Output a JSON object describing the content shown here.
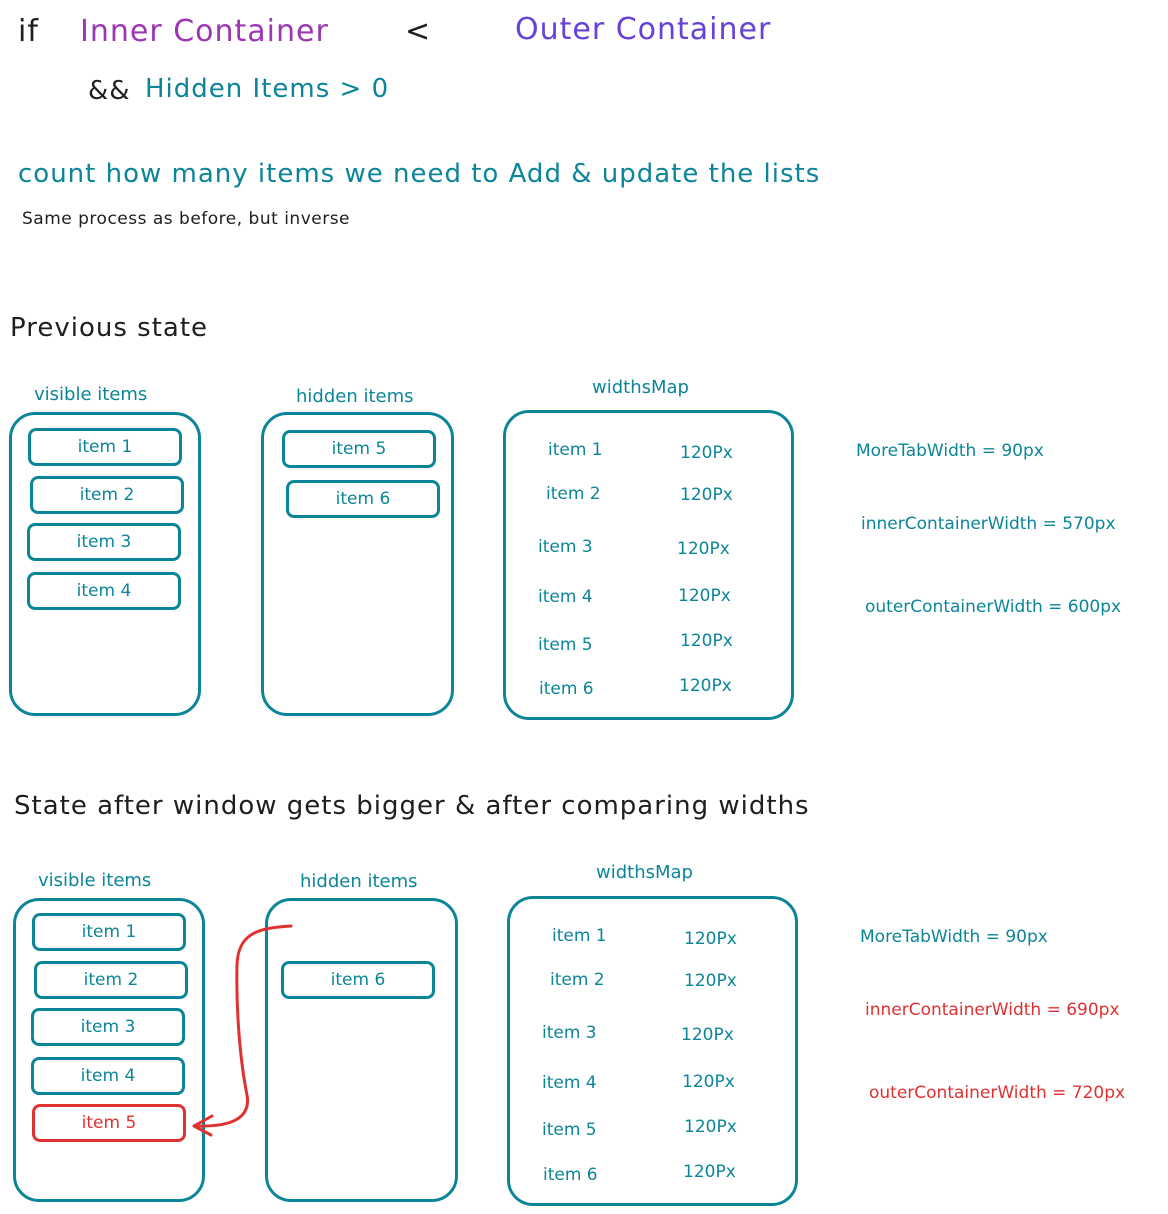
{
  "condition": {
    "if_kw": "if",
    "left": "Inner Container",
    "op": "<",
    "right": "Outer Container",
    "and_kw": "&&",
    "second": "Hidden Items > 0"
  },
  "intro": {
    "title": "count how many items we need to Add & update the lists",
    "subtitle": "Same process as before, but inverse"
  },
  "previous": {
    "heading": "Previous state",
    "visible_label": "visible items",
    "visible": [
      "item 1",
      "item 2",
      "item 3",
      "item 4"
    ],
    "hidden_label": "hidden items",
    "hidden": [
      "item 5",
      "item 6"
    ],
    "widths_label": "widthsMap",
    "widths": [
      {
        "name": "item 1",
        "value": "120Px"
      },
      {
        "name": "item 2",
        "value": "120Px"
      },
      {
        "name": "item 3",
        "value": "120Px"
      },
      {
        "name": "item 4",
        "value": "120Px"
      },
      {
        "name": "item 5",
        "value": "120Px"
      },
      {
        "name": "item 6",
        "value": "120Px"
      }
    ],
    "more_tab": "MoreTabWidth = 90px",
    "inner": "innerContainerWidth =  570px",
    "outer": "outerContainerWidth = 600px"
  },
  "after": {
    "heading": "State after window gets bigger & after comparing widths",
    "visible_label": "visible items",
    "visible": [
      "item 1",
      "item 2",
      "item 3",
      "item 4",
      "item 5"
    ],
    "hidden_label": "hidden items",
    "hidden": [
      "item 6"
    ],
    "widths_label": "widthsMap",
    "widths": [
      {
        "name": "item 1",
        "value": "120Px"
      },
      {
        "name": "item 2",
        "value": "120Px"
      },
      {
        "name": "item 3",
        "value": "120Px"
      },
      {
        "name": "item 4",
        "value": "120Px"
      },
      {
        "name": "item 5",
        "value": "120Px"
      },
      {
        "name": "item 6",
        "value": "120Px"
      }
    ],
    "more_tab": "MoreTabWidth = 90px",
    "inner": "innerContainerWidth =  690px",
    "outer": "outerContainerWidth = 720px"
  },
  "colors": {
    "teal": "#0c8599",
    "red": "#e03131",
    "purple_inner": "#9c36b5",
    "purple_outer": "#6741d9",
    "text": "#1e1e1e"
  }
}
